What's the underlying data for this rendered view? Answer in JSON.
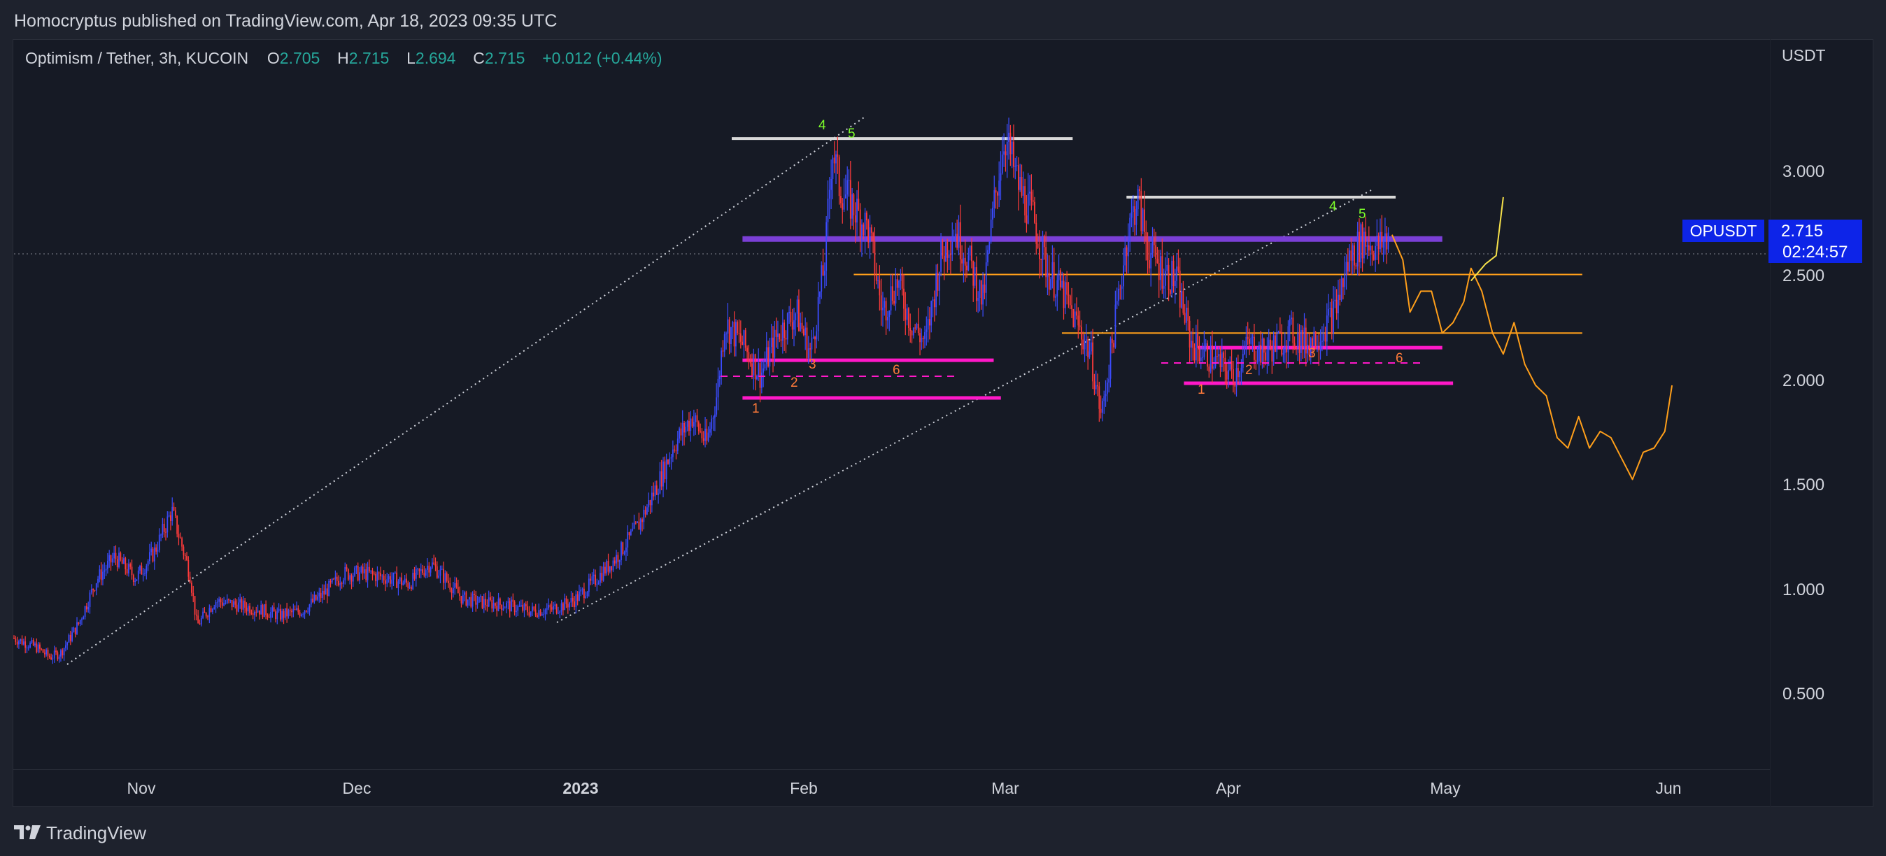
{
  "header": {
    "publish_text": "Homocryptus published on TradingView.com, Apr 18, 2023 09:35 UTC"
  },
  "legend": {
    "symbol": "Optimism / Tether, 3h, KUCOIN",
    "open_label": "O",
    "open": "2.705",
    "high_label": "H",
    "high": "2.715",
    "low_label": "L",
    "low": "2.694",
    "close_label": "C",
    "close": "2.715",
    "change": "+0.012 (+0.44%)"
  },
  "price_axis": {
    "currency": "USDT",
    "ticks": [
      "3.000",
      "2.500",
      "2.000",
      "1.500",
      "1.000",
      "0.500"
    ]
  },
  "time_axis": {
    "ticks": [
      "Nov",
      "Dec",
      "2023",
      "Feb",
      "Mar",
      "Apr",
      "May",
      "Jun"
    ]
  },
  "last_price": {
    "symbol": "OPUSDT",
    "price": "2.715",
    "countdown": "02:24:57"
  },
  "annotations": {
    "wave_left": [
      "1",
      "2",
      "3",
      "4",
      "5",
      "6"
    ],
    "wave_right": [
      "1",
      "2",
      "3",
      "4",
      "5",
      "6"
    ]
  },
  "brand": {
    "name": "TradingView"
  },
  "colors": {
    "background": "#161a25",
    "up": "#3b4cff",
    "down": "#ff3b3b",
    "magenta": "#ff18c8",
    "purple": "#7b3fd6",
    "orange": "#ff9f1a",
    "yellow": "#f5e04a",
    "last_price_tag": "#0d24e8"
  },
  "chart_data": {
    "type": "candlestick",
    "symbol": "Optimism / Tether, 3h, KUCOIN",
    "ylim": [
      0.2,
      3.8
    ],
    "y_ticks": [
      0.5,
      1.0,
      1.5,
      2.0,
      2.5,
      3.0
    ],
    "x_labels": [
      "Nov",
      "Dec",
      "2023",
      "Feb",
      "Mar",
      "Apr",
      "May",
      "Jun"
    ],
    "price_path": [
      [
        0.0,
        0.79
      ],
      [
        0.6,
        0.75
      ],
      [
        1.0,
        0.7
      ],
      [
        1.3,
        0.72
      ],
      [
        1.8,
        0.86
      ],
      [
        2.3,
        1.07
      ],
      [
        2.8,
        1.18
      ],
      [
        3.4,
        1.08
      ],
      [
        3.9,
        1.2
      ],
      [
        4.4,
        1.4
      ],
      [
        4.9,
        1.1
      ],
      [
        5.1,
        0.85
      ],
      [
        5.6,
        0.97
      ],
      [
        6.2,
        0.95
      ],
      [
        6.8,
        0.93
      ],
      [
        7.4,
        0.9
      ],
      [
        8.0,
        0.92
      ],
      [
        8.6,
        1.0
      ],
      [
        9.2,
        1.1
      ],
      [
        9.8,
        1.1
      ],
      [
        10.4,
        1.08
      ],
      [
        11.0,
        1.05
      ],
      [
        11.6,
        1.15
      ],
      [
        12.0,
        1.08
      ],
      [
        12.5,
        0.98
      ],
      [
        13.1,
        0.96
      ],
      [
        13.7,
        0.95
      ],
      [
        14.4,
        0.92
      ],
      [
        15.0,
        0.93
      ],
      [
        15.6,
        0.97
      ],
      [
        16.2,
        1.07
      ],
      [
        16.8,
        1.18
      ],
      [
        17.4,
        1.33
      ],
      [
        18.0,
        1.55
      ],
      [
        18.4,
        1.72
      ],
      [
        18.9,
        1.85
      ],
      [
        19.3,
        1.72
      ],
      [
        19.6,
        1.97
      ],
      [
        19.8,
        2.3
      ],
      [
        20.3,
        2.2
      ],
      [
        20.8,
        2.05
      ],
      [
        21.3,
        2.25
      ],
      [
        21.8,
        2.35
      ],
      [
        22.2,
        2.15
      ],
      [
        22.6,
        2.6
      ],
      [
        22.8,
        3.15
      ],
      [
        23.0,
        2.95
      ],
      [
        23.4,
        2.85
      ],
      [
        23.8,
        2.75
      ],
      [
        24.2,
        2.35
      ],
      [
        24.6,
        2.5
      ],
      [
        25.0,
        2.3
      ],
      [
        25.4,
        2.2
      ],
      [
        25.8,
        2.6
      ],
      [
        26.2,
        2.75
      ],
      [
        26.6,
        2.6
      ],
      [
        27.0,
        2.4
      ],
      [
        27.3,
        2.85
      ],
      [
        27.6,
        3.2
      ],
      [
        28.0,
        2.95
      ],
      [
        28.4,
        2.8
      ],
      [
        28.8,
        2.55
      ],
      [
        29.2,
        2.45
      ],
      [
        29.6,
        2.3
      ],
      [
        30.0,
        2.15
      ],
      [
        30.3,
        1.85
      ],
      [
        30.6,
        2.2
      ],
      [
        31.0,
        2.7
      ],
      [
        31.3,
        2.9
      ],
      [
        31.6,
        2.65
      ],
      [
        32.0,
        2.55
      ],
      [
        32.4,
        2.5
      ],
      [
        32.8,
        2.2
      ],
      [
        33.2,
        2.15
      ],
      [
        33.6,
        2.1
      ],
      [
        34.0,
        2.05
      ],
      [
        34.4,
        2.2
      ],
      [
        34.8,
        2.15
      ],
      [
        35.2,
        2.2
      ],
      [
        35.6,
        2.25
      ],
      [
        36.0,
        2.2
      ],
      [
        36.4,
        2.25
      ],
      [
        36.8,
        2.35
      ],
      [
        37.2,
        2.6
      ],
      [
        37.6,
        2.7
      ],
      [
        38.0,
        2.65
      ],
      [
        38.3,
        2.72
      ]
    ],
    "projection": [
      [
        38.4,
        2.72
      ],
      [
        38.7,
        2.6
      ],
      [
        38.9,
        2.35
      ],
      [
        39.2,
        2.45
      ],
      [
        39.5,
        2.45
      ],
      [
        39.8,
        2.25
      ],
      [
        40.1,
        2.3
      ],
      [
        40.4,
        2.4
      ],
      [
        40.6,
        2.56
      ],
      [
        40.9,
        2.45
      ],
      [
        41.2,
        2.25
      ],
      [
        41.5,
        2.15
      ],
      [
        41.8,
        2.3
      ],
      [
        42.1,
        2.1
      ],
      [
        42.4,
        2.0
      ],
      [
        42.7,
        1.95
      ],
      [
        43.0,
        1.75
      ],
      [
        43.3,
        1.7
      ],
      [
        43.6,
        1.85
      ],
      [
        43.9,
        1.7
      ],
      [
        44.2,
        1.78
      ],
      [
        44.5,
        1.75
      ],
      [
        44.8,
        1.65
      ],
      [
        45.1,
        1.55
      ],
      [
        45.4,
        1.68
      ],
      [
        45.7,
        1.7
      ],
      [
        46.0,
        1.78
      ],
      [
        46.2,
        2.0
      ]
    ],
    "bullish_projection": [
      [
        40.6,
        2.5
      ],
      [
        41.0,
        2.58
      ],
      [
        41.3,
        2.62
      ],
      [
        41.5,
        2.9
      ]
    ],
    "levels": [
      {
        "name": "top-resistance-left",
        "y": 3.18,
        "x": [
          20.0,
          29.5
        ],
        "color": "#ffffff"
      },
      {
        "name": "top-resistance-right",
        "y": 2.9,
        "x": [
          31.0,
          38.5
        ],
        "color": "#ffffff"
      },
      {
        "name": "purple-zone",
        "y": 2.7,
        "x": [
          20.3,
          39.8
        ],
        "color": "#7b3fd6"
      },
      {
        "name": "orange-line-upper",
        "y": 2.53,
        "x": [
          23.4,
          43.7
        ],
        "color": "#ff9f1a"
      },
      {
        "name": "orange-line-lower",
        "y": 2.25,
        "x": [
          29.2,
          43.7
        ],
        "color": "#ff9f1a"
      },
      {
        "name": "magenta-left-top",
        "y": 2.12,
        "x": [
          20.3,
          27.3
        ],
        "color": "#ff18c8"
      },
      {
        "name": "magenta-left-bottom",
        "y": 1.94,
        "x": [
          20.3,
          27.5
        ],
        "color": "#ff18c8"
      },
      {
        "name": "magenta-right-top",
        "y": 2.18,
        "x": [
          33.0,
          39.8
        ],
        "color": "#ff18c8"
      },
      {
        "name": "magenta-right-bottom",
        "y": 2.01,
        "x": [
          32.6,
          40.1
        ],
        "color": "#ff18c8"
      }
    ]
  }
}
